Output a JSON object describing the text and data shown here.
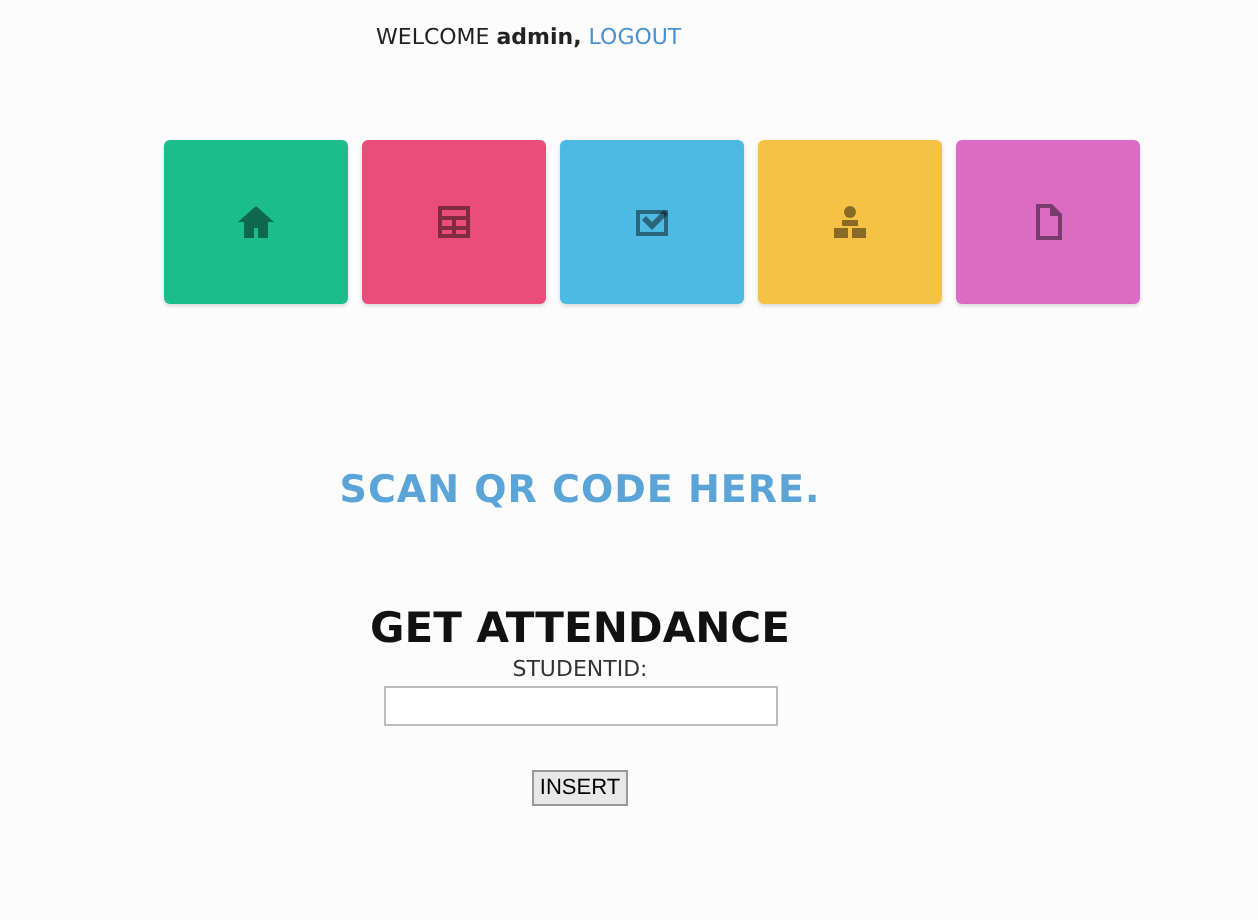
{
  "header": {
    "welcome": "WELCOME",
    "user": "admin,",
    "logout": "LOGOUT"
  },
  "tiles": [
    {
      "kind": "home",
      "color": "#1bbd8b"
    },
    {
      "kind": "table",
      "color": "#ea4d7a"
    },
    {
      "kind": "check",
      "color": "#4cbae2"
    },
    {
      "kind": "people",
      "color": "#f6c246"
    },
    {
      "kind": "file",
      "color": "#dc6cc3"
    }
  ],
  "scan_title": "SCAN QR CODE HERE.",
  "form": {
    "title": "GET ATTENDANCE",
    "label": "STUDENTID:",
    "button": "INSERT"
  }
}
